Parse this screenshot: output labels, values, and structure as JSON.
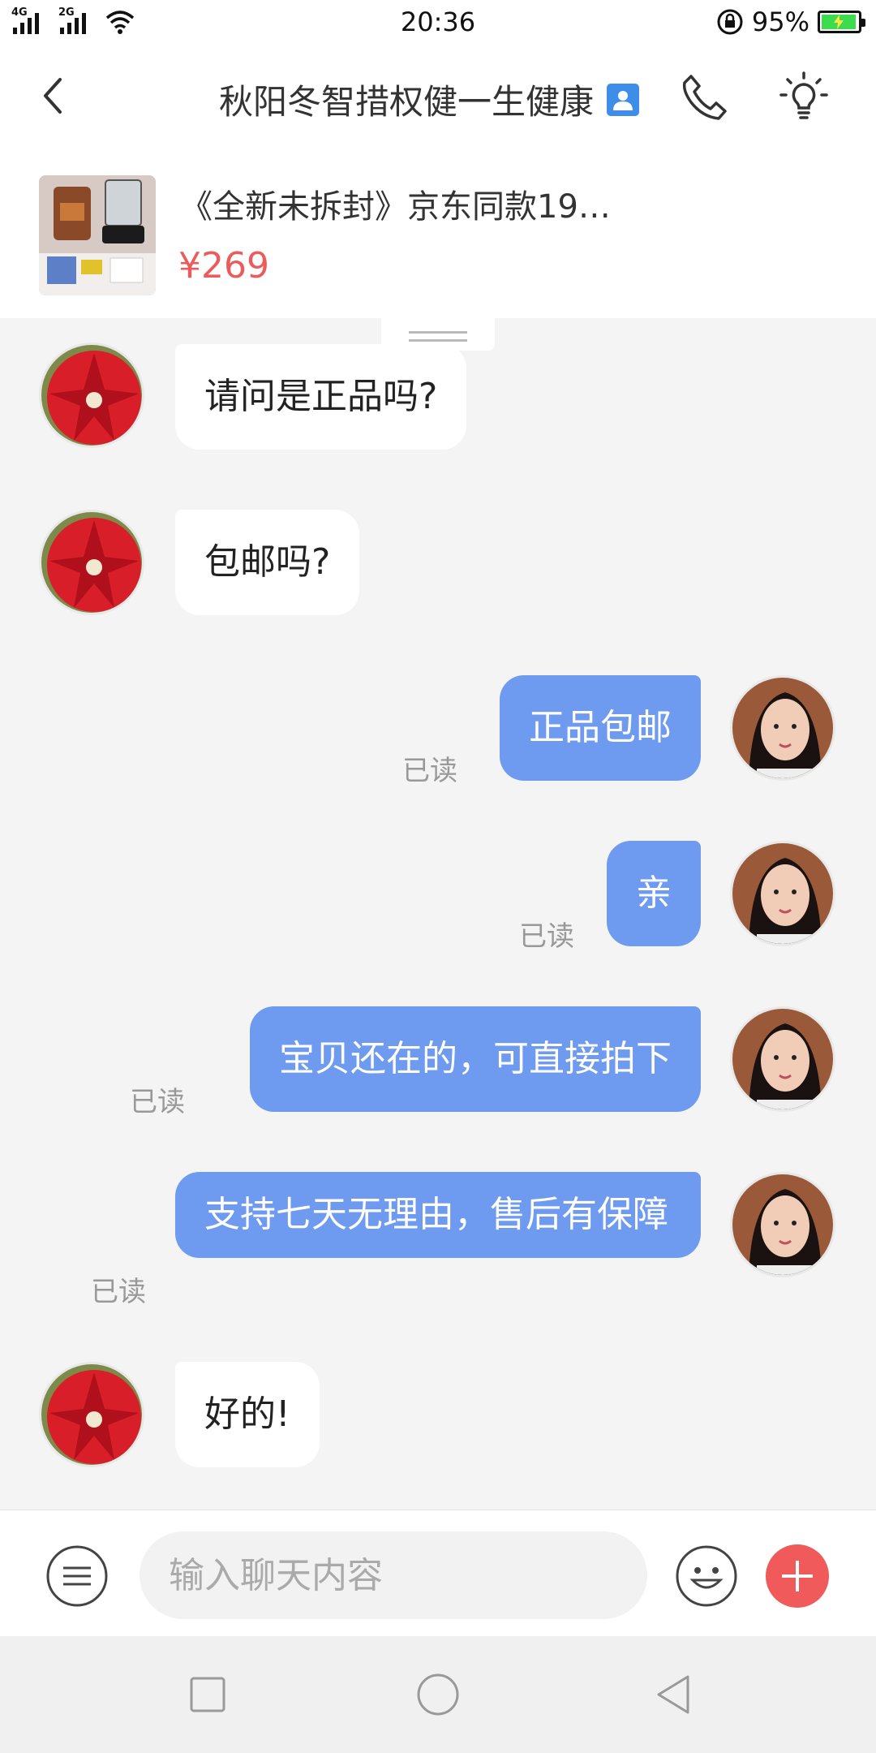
{
  "status_bar": {
    "network_1": "4G",
    "network_2": "2G",
    "time": "20:36",
    "battery_percent": "95%",
    "battery_level": 0.95
  },
  "header": {
    "title": "秋阳冬智措权健一生健康"
  },
  "product": {
    "title": "《全新未拆封》京东同款19…",
    "price": "¥269"
  },
  "messages": [
    {
      "side": "in",
      "text": "请问是正品吗?"
    },
    {
      "side": "in",
      "text": "包邮吗?"
    },
    {
      "side": "out",
      "text": "正品包邮",
      "status": "已读"
    },
    {
      "side": "out",
      "text": "亲",
      "status": "已读"
    },
    {
      "side": "out",
      "text": "宝贝还在的，可直接拍下",
      "status": "已读"
    },
    {
      "side": "out",
      "text": "支持七天无理由，售后有保障",
      "status": "已读"
    },
    {
      "side": "in",
      "text": "好的!"
    }
  ],
  "input": {
    "placeholder": "输入聊天内容"
  },
  "colors": {
    "accent_blue": "#6e9bf0",
    "price_red": "#ec5b5b",
    "plus_red": "#f05a5a",
    "battery_green": "#3ddc4e"
  },
  "icons": {
    "back": "chevron-left-icon",
    "contact": "contact-card-icon",
    "phone": "phone-icon",
    "bulb": "lightbulb-icon",
    "menu": "menu-icon",
    "emoji": "smiley-icon",
    "plus": "plus-icon",
    "nav_recent": "square-icon",
    "nav_home": "circle-icon",
    "nav_back": "triangle-back-icon"
  }
}
